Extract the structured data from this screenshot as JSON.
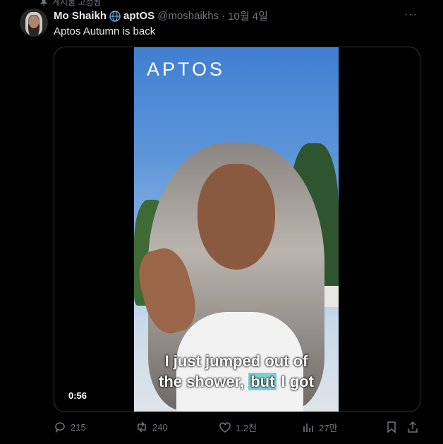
{
  "pinned": {
    "label": "게시물 고정됨"
  },
  "tweet": {
    "author_name": "Mo Shaikh",
    "verified_org": "aptOS",
    "handle": "@moshaikhs",
    "separator": "·",
    "date": "10월 4일",
    "text": "Aptos Autumn is back"
  },
  "video": {
    "logo": "APTOS",
    "caption_line1": "I just jumped out of",
    "caption_line2_a": "the shower, ",
    "caption_line2_hl": "but",
    "caption_line2_b": " I got",
    "duration": "0:56"
  },
  "actions": {
    "replies": "215",
    "reposts": "240",
    "likes": "1.2천",
    "views": "27만"
  },
  "icons": [
    "pin-icon",
    "globe-icon",
    "more-icon",
    "reply-icon",
    "repost-icon",
    "like-icon",
    "views-icon",
    "bookmark-icon",
    "share-icon"
  ],
  "colors": {
    "background": "#000000",
    "text": "#e7e9ea",
    "muted": "#71767b",
    "caption_highlight": "#7ecfd2"
  }
}
